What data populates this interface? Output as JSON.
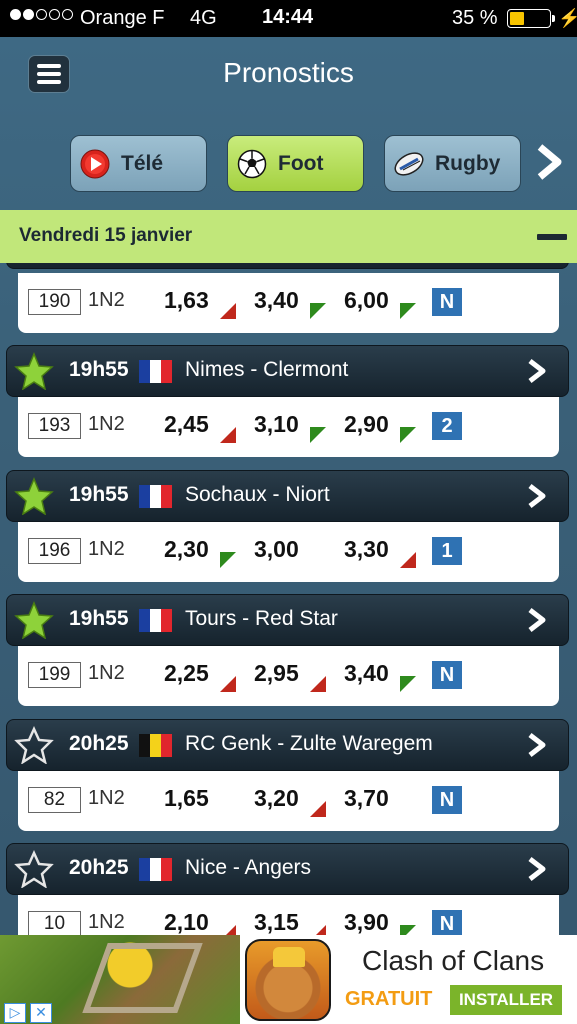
{
  "status_bar": {
    "signal_dots_filled": 2,
    "signal_dots_total": 5,
    "carrier": "Orange F",
    "network": "4G",
    "time": "14:44",
    "battery_percent": "35 %",
    "battery_level": 0.35,
    "battery_color": "#f7c400",
    "charge_icon": "lightning-icon"
  },
  "header": {
    "menu_icon": "hamburger-icon",
    "title": "Pronostics"
  },
  "tabs": [
    {
      "label": "Télé",
      "icon": "play-icon",
      "active": false
    },
    {
      "label": "Foot",
      "icon": "soccer-ball-icon",
      "active": true
    },
    {
      "label": "Rugby",
      "icon": "rugby-ball-icon",
      "active": false
    }
  ],
  "tabs_next_icon": "chevron-right-icon",
  "date_section": {
    "label": "Vendredi 15 janvier",
    "collapse_icon": "minus-icon"
  },
  "partial_match": {
    "number": "190",
    "bet_type": "1N2",
    "odds": [
      {
        "value": "1,63",
        "trend": "down"
      },
      {
        "value": "3,40",
        "trend": "up"
      },
      {
        "value": "6,00",
        "trend": "up"
      }
    ],
    "prediction": "N"
  },
  "matches": [
    {
      "favorite": true,
      "time": "19h55",
      "country_flag": "france",
      "teams": "Nimes - Clermont",
      "number": "193",
      "bet_type": "1N2",
      "odds": [
        {
          "value": "2,45",
          "trend": "down"
        },
        {
          "value": "3,10",
          "trend": "up"
        },
        {
          "value": "2,90",
          "trend": "up"
        }
      ],
      "prediction": "2"
    },
    {
      "favorite": true,
      "time": "19h55",
      "country_flag": "france",
      "teams": "Sochaux - Niort",
      "number": "196",
      "bet_type": "1N2",
      "odds": [
        {
          "value": "2,30",
          "trend": "up"
        },
        {
          "value": "3,00",
          "trend": "none"
        },
        {
          "value": "3,30",
          "trend": "down"
        }
      ],
      "prediction": "1"
    },
    {
      "favorite": true,
      "time": "19h55",
      "country_flag": "france",
      "teams": "Tours - Red Star",
      "number": "199",
      "bet_type": "1N2",
      "odds": [
        {
          "value": "2,25",
          "trend": "down"
        },
        {
          "value": "2,95",
          "trend": "down"
        },
        {
          "value": "3,40",
          "trend": "up"
        }
      ],
      "prediction": "N"
    },
    {
      "favorite": false,
      "time": "20h25",
      "country_flag": "belgium",
      "teams": "RC Genk - Zulte Waregem",
      "number": "82",
      "bet_type": "1N2",
      "odds": [
        {
          "value": "1,65",
          "trend": "none"
        },
        {
          "value": "3,20",
          "trend": "down"
        },
        {
          "value": "3,70",
          "trend": "none"
        }
      ],
      "prediction": "N"
    },
    {
      "favorite": false,
      "time": "20h25",
      "country_flag": "france",
      "teams": "Nice - Angers",
      "number": "10",
      "bet_type": "1N2",
      "odds": [
        {
          "value": "2,10",
          "trend": "down"
        },
        {
          "value": "3,15",
          "trend": "down"
        },
        {
          "value": "3,90",
          "trend": "up"
        }
      ],
      "prediction": "N"
    }
  ],
  "ad": {
    "title": "Clash of Clans",
    "price": "GRATUIT",
    "install_label": "INSTALLER",
    "info_icon": "ad-info-icon",
    "close_icon": "ad-close-icon"
  },
  "colors": {
    "accent_green": "#c1e77a",
    "prediction_blue": "#2f72b3",
    "odds_up": "#2e8a1d",
    "odds_down": "#c0281c",
    "favorite_star": "#8ed23a"
  }
}
